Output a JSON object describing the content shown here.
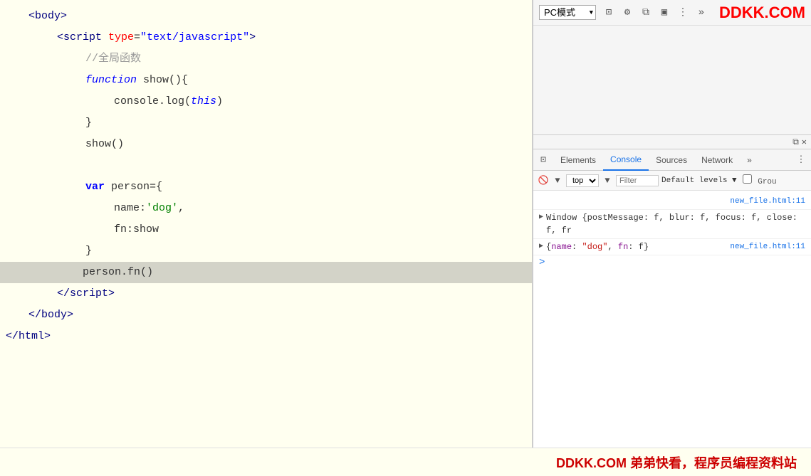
{
  "code": {
    "lines": [
      {
        "id": "line-body-open",
        "indent": "indent1",
        "highlighted": false,
        "parts": [
          {
            "text": "<",
            "class": "c-tag"
          },
          {
            "text": "body",
            "class": "c-tag"
          },
          {
            "text": ">",
            "class": "c-tag"
          }
        ]
      },
      {
        "id": "line-script-open",
        "indent": "indent2",
        "highlighted": false,
        "parts": [
          {
            "text": "<",
            "class": "c-tag"
          },
          {
            "text": "script ",
            "class": "c-tag"
          },
          {
            "text": "type",
            "class": "c-attr"
          },
          {
            "text": "=",
            "class": "c-normal"
          },
          {
            "text": "\"text/javascript\"",
            "class": "c-attrval"
          },
          {
            "text": ">",
            "class": "c-tag"
          }
        ]
      },
      {
        "id": "line-comment",
        "indent": "indent3",
        "highlighted": false,
        "parts": [
          {
            "text": "//全局函数",
            "class": "c-comment"
          }
        ]
      },
      {
        "id": "line-function",
        "indent": "indent3",
        "highlighted": false,
        "parts": [
          {
            "text": "function",
            "class": "c-keyword"
          },
          {
            "text": " show(){",
            "class": "c-normal"
          }
        ]
      },
      {
        "id": "line-console",
        "indent": "indent4",
        "highlighted": false,
        "parts": [
          {
            "text": "console.log(",
            "class": "c-normal"
          },
          {
            "text": "this",
            "class": "c-this"
          },
          {
            "text": ")",
            "class": "c-normal"
          }
        ]
      },
      {
        "id": "line-close-func",
        "indent": "indent3",
        "highlighted": false,
        "parts": [
          {
            "text": "}",
            "class": "c-normal"
          }
        ]
      },
      {
        "id": "line-show-call",
        "indent": "indent3",
        "highlighted": false,
        "parts": [
          {
            "text": "show()",
            "class": "c-normal"
          }
        ]
      },
      {
        "id": "line-empty1",
        "indent": "indent3",
        "highlighted": false,
        "parts": [
          {
            "text": "",
            "class": "c-normal"
          }
        ]
      },
      {
        "id": "line-var-person",
        "indent": "indent3",
        "highlighted": false,
        "parts": [
          {
            "text": "var",
            "class": "c-var"
          },
          {
            "text": " person={",
            "class": "c-normal"
          }
        ]
      },
      {
        "id": "line-name",
        "indent": "indent4",
        "highlighted": false,
        "parts": [
          {
            "text": "name:",
            "class": "c-normal"
          },
          {
            "text": "'dog'",
            "class": "c-string"
          },
          {
            "text": ",",
            "class": "c-normal"
          }
        ]
      },
      {
        "id": "line-fn",
        "indent": "indent4",
        "highlighted": false,
        "parts": [
          {
            "text": "fn:show",
            "class": "c-normal"
          }
        ]
      },
      {
        "id": "line-close-obj",
        "indent": "indent3",
        "highlighted": false,
        "parts": [
          {
            "text": "}",
            "class": "c-normal"
          }
        ]
      },
      {
        "id": "line-person-fn",
        "indent": "indent3",
        "highlighted": true,
        "parts": [
          {
            "text": "        person.fn()",
            "class": "c-normal"
          }
        ]
      },
      {
        "id": "line-script-close",
        "indent": "indent2",
        "highlighted": false,
        "parts": [
          {
            "text": "</",
            "class": "c-tag"
          },
          {
            "text": "script",
            "class": "c-tag"
          },
          {
            "text": ">",
            "class": "c-tag"
          }
        ]
      },
      {
        "id": "line-body-close",
        "indent": "indent1",
        "highlighted": false,
        "parts": [
          {
            "text": "</",
            "class": "c-tag"
          },
          {
            "text": "body",
            "class": "c-tag"
          },
          {
            "text": ">",
            "class": "c-tag"
          }
        ]
      },
      {
        "id": "line-html-close",
        "indent": "",
        "highlighted": false,
        "parts": [
          {
            "text": "</",
            "class": "c-tag"
          },
          {
            "text": "html",
            "class": "c-tag"
          },
          {
            "text": ">",
            "class": "c-tag"
          }
        ]
      }
    ]
  },
  "devtools": {
    "pc_mode_label": "PC模式",
    "logo": "DDKK.COM",
    "tabs": [
      "Elements",
      "Console",
      "Sources",
      "Network",
      "»"
    ],
    "active_tab": "Console",
    "toolbar": {
      "top_label": "top",
      "filter_placeholder": "Filter",
      "levels_label": "Default levels ▼",
      "group_label": "Grou"
    },
    "console_rows": [
      {
        "type": "link",
        "text": "new_file.html:11",
        "link": "new_file.html:11"
      },
      {
        "type": "object",
        "triangle": "▶",
        "text": "Window {postMessage: f, blur: f, focus: f, close: f, fr",
        "link": ""
      },
      {
        "type": "object",
        "triangle": "▶",
        "text": "{name: \"dog\", fn: f}",
        "link": "new_file.html:11"
      }
    ],
    "caret": ">"
  },
  "watermark": {
    "text": "DDKK.COM 弟弟快看，程序员编程资料站"
  }
}
